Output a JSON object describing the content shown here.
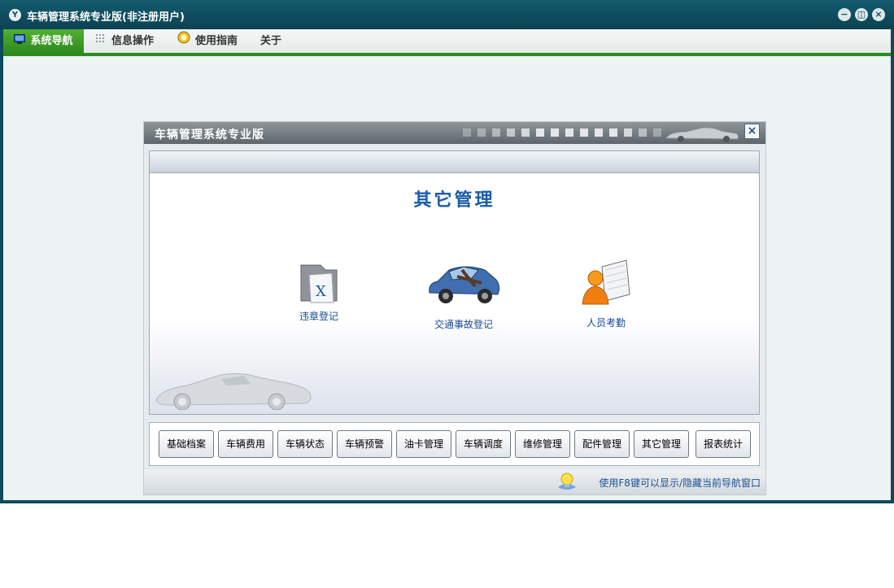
{
  "window": {
    "logo": "Y",
    "title": "车辆管理系统专业版(非注册用户)",
    "controls": {
      "minimize": "−",
      "restore": "◫",
      "close": "×"
    }
  },
  "menu": [
    {
      "label": "系统导航",
      "icon": "monitor-icon"
    },
    {
      "label": "信息操作",
      "icon": "grid-icon"
    },
    {
      "label": "使用指南",
      "icon": "guide-icon"
    },
    {
      "label": "关于"
    }
  ],
  "nav_panel": {
    "title": "车辆管理系统专业版",
    "close": "×",
    "section_title": "其它管理",
    "modules": [
      {
        "label": "违章登记",
        "icon": "folder-document-icon"
      },
      {
        "label": "交通事故登记",
        "icon": "car-accident-icon"
      },
      {
        "label": "人员考勤",
        "icon": "person-book-icon"
      }
    ],
    "buttons": [
      "基础档案",
      "车辆费用",
      "车辆状态",
      "车辆预警",
      "油卡管理",
      "车辆调度",
      "维修管理",
      "配件管理",
      "其它管理",
      "报表统计"
    ],
    "tip": "使用F8键可以显示/隐藏当前导航窗口"
  },
  "colors": {
    "titlebar": "#0d4a5c",
    "menu_active": "#2e8a1e",
    "section_title": "#1a5ca8",
    "module_label": "#17498f"
  }
}
